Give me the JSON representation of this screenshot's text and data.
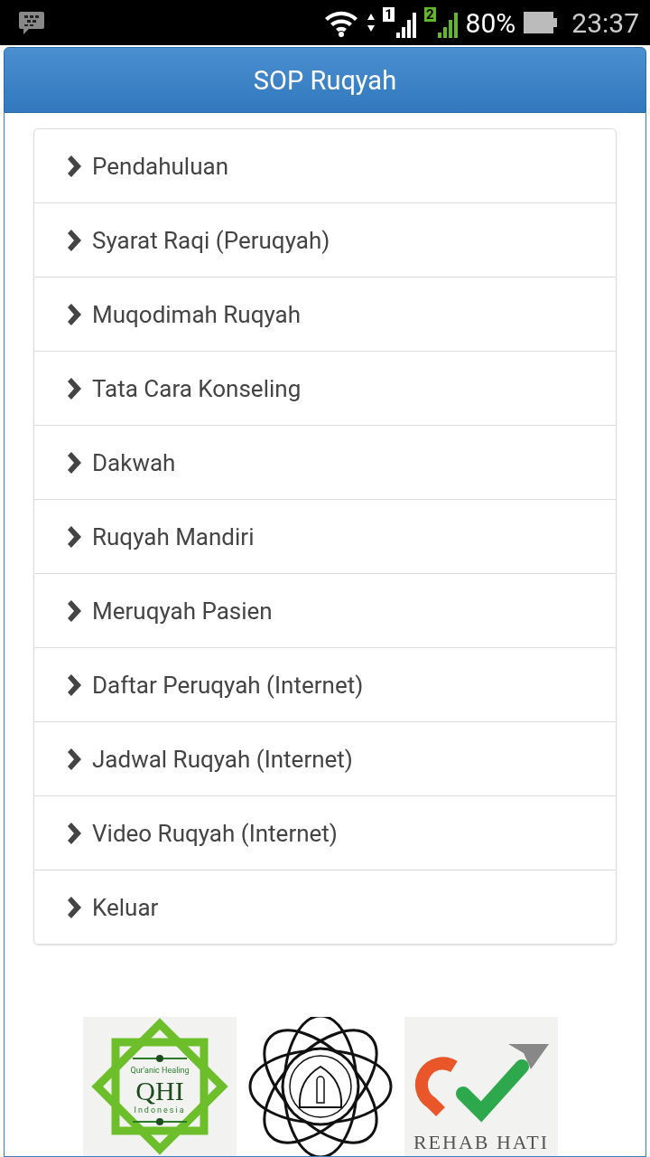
{
  "status_bar": {
    "sim_labels": [
      "1",
      "2"
    ],
    "battery": "80%",
    "time": "23:37"
  },
  "header": {
    "title": "SOP Ruqyah"
  },
  "menu": [
    {
      "label": "Pendahuluan"
    },
    {
      "label": "Syarat Raqi (Peruqyah)"
    },
    {
      "label": "Muqodimah Ruqyah"
    },
    {
      "label": "Tata Cara Konseling"
    },
    {
      "label": "Dakwah"
    },
    {
      "label": "Ruqyah Mandiri"
    },
    {
      "label": "Meruqyah Pasien"
    },
    {
      "label": "Daftar Peruqyah (Internet)"
    },
    {
      "label": "Jadwal Ruqyah (Internet)"
    },
    {
      "label": "Video Ruqyah (Internet)"
    },
    {
      "label": "Keluar"
    }
  ],
  "logos": [
    {
      "kind": "qhi",
      "texts": [
        "Qur'anic Healing",
        "QHI",
        "Indonesia"
      ]
    },
    {
      "kind": "emblem"
    },
    {
      "kind": "rehab",
      "texts": [
        "REHAB HATI"
      ]
    }
  ]
}
